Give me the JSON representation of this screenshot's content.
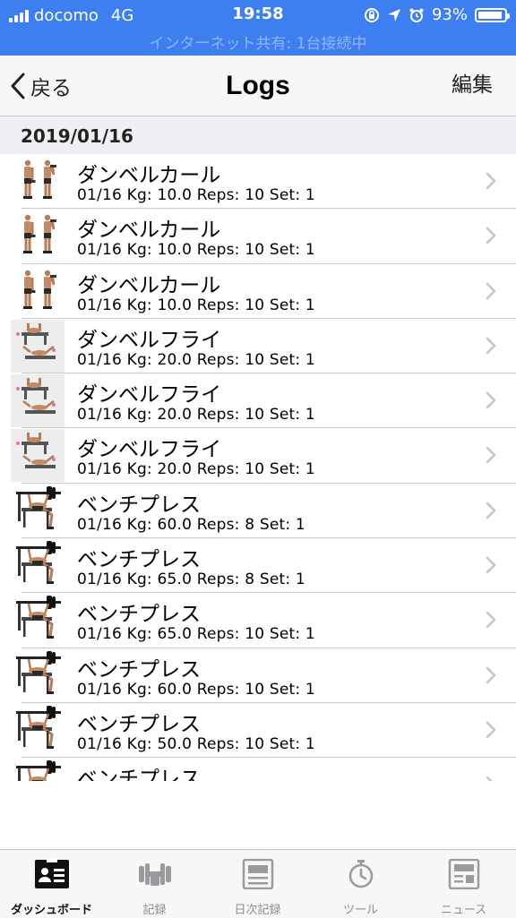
{
  "status_bar": {
    "carrier": "docomo",
    "network": "4G",
    "time": "19:58",
    "battery": "93%",
    "battery_level": 0.93,
    "hotspot": "インターネット共有: 1台接続中",
    "background_color": "#3d7ff0"
  },
  "nav": {
    "back_label": "戻る",
    "title": "Logs",
    "edit_label": "編集"
  },
  "section": {
    "date": "2019/01/16"
  },
  "rows": [
    {
      "title": "ダンベルカール",
      "detail": "01/16  Kg: 10.0  Reps: 10  Set: 1",
      "icon": "dumbbell-curl-thumbnail"
    },
    {
      "title": "ダンベルカール",
      "detail": "01/16  Kg: 10.0  Reps: 10  Set: 1",
      "icon": "dumbbell-curl-thumbnail"
    },
    {
      "title": "ダンベルカール",
      "detail": "01/16  Kg: 10.0  Reps: 10  Set: 1",
      "icon": "dumbbell-curl-thumbnail"
    },
    {
      "title": "ダンベルフライ",
      "detail": "01/16  Kg: 20.0  Reps: 10  Set: 1",
      "icon": "dumbbell-fly-thumbnail"
    },
    {
      "title": "ダンベルフライ",
      "detail": "01/16  Kg: 20.0  Reps: 10  Set: 1",
      "icon": "dumbbell-fly-thumbnail"
    },
    {
      "title": "ダンベルフライ",
      "detail": "01/16  Kg: 20.0  Reps: 10  Set: 1",
      "icon": "dumbbell-fly-thumbnail"
    },
    {
      "title": "ベンチプレス",
      "detail": "01/16  Kg: 60.0  Reps: 8  Set: 1",
      "icon": "bench-press-thumbnail"
    },
    {
      "title": "ベンチプレス",
      "detail": "01/16  Kg: 65.0  Reps: 8  Set: 1",
      "icon": "bench-press-thumbnail"
    },
    {
      "title": "ベンチプレス",
      "detail": "01/16  Kg: 65.0  Reps: 10  Set: 1",
      "icon": "bench-press-thumbnail"
    },
    {
      "title": "ベンチプレス",
      "detail": "01/16  Kg: 60.0  Reps: 10  Set: 1",
      "icon": "bench-press-thumbnail"
    },
    {
      "title": "ベンチプレス",
      "detail": "01/16  Kg: 50.0  Reps: 10  Set: 1",
      "icon": "bench-press-thumbnail"
    },
    {
      "title": "ベンチプレス",
      "detail": "",
      "icon": "bench-press-thumbnail"
    }
  ],
  "tabs": [
    {
      "label": "ダッシュボード",
      "icon": "dashboard-icon",
      "active": true
    },
    {
      "label": "記録",
      "icon": "dumbbell-icon",
      "active": false
    },
    {
      "label": "日次記録",
      "icon": "daily-log-icon",
      "active": false
    },
    {
      "label": "ツール",
      "icon": "stopwatch-icon",
      "active": false
    },
    {
      "label": "ニュース",
      "icon": "news-icon",
      "active": false
    }
  ]
}
